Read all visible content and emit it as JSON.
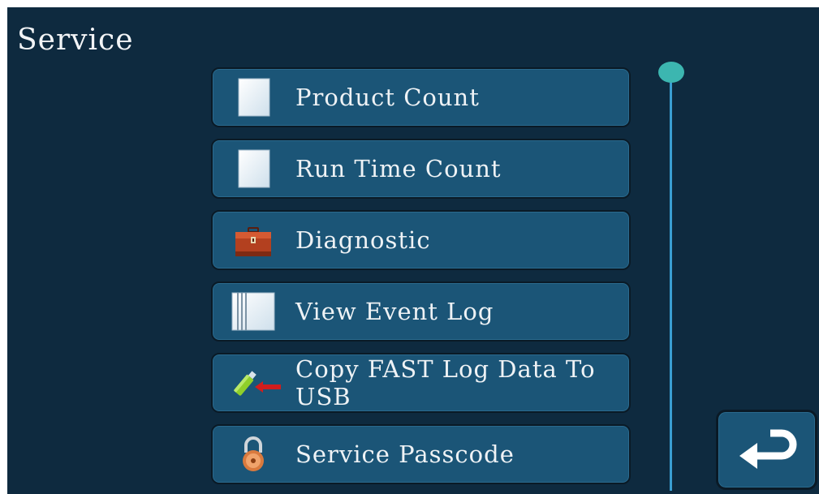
{
  "header": {
    "title": "Service"
  },
  "menu": {
    "items": [
      {
        "label": "Product Count",
        "icon": "document-icon"
      },
      {
        "label": "Run Time Count",
        "icon": "document-icon"
      },
      {
        "label": "Diagnostic",
        "icon": "toolbox-icon"
      },
      {
        "label": "View Event Log",
        "icon": "log-book-icon"
      },
      {
        "label": "Copy FAST Log Data To USB",
        "icon": "usb-copy-icon"
      },
      {
        "label": "Service Passcode",
        "icon": "padlock-icon"
      }
    ]
  },
  "navigation": {
    "back_icon": "return-arrow-icon"
  },
  "colors": {
    "background": "#0e2a3f",
    "button": "#1b5577",
    "scrollbar": "#3a9ed2",
    "scroll_thumb": "#3cb6b0"
  }
}
